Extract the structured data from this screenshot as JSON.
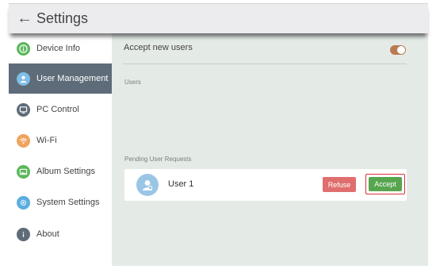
{
  "header": {
    "back_glyph": "←",
    "title": "Settings"
  },
  "sidebar": {
    "items": [
      {
        "label": "Device Info",
        "icon": "info-icon",
        "color": "#5cb85c",
        "active": false
      },
      {
        "label": "User Management",
        "icon": "user-icon",
        "color": "#7fbde8",
        "active": true
      },
      {
        "label": "PC Control",
        "icon": "monitor-icon",
        "color": "#5d6c78",
        "active": false
      },
      {
        "label": "Wi-Fi",
        "icon": "wifi-icon",
        "color": "#f0a35c",
        "active": false
      },
      {
        "label": "Album Settings",
        "icon": "image-icon",
        "color": "#5cb85c",
        "active": false
      },
      {
        "label": "System Settings",
        "icon": "gear-icon",
        "color": "#5aaee0",
        "active": false
      },
      {
        "label": "About",
        "icon": "info-icon",
        "color": "#5d6c78",
        "active": false
      }
    ]
  },
  "main": {
    "accept_new_users_label": "Accept new users",
    "accept_new_users_on": true,
    "users_section_label": "Users",
    "pending_section_label": "Pending User Requests",
    "pending_requests": [
      {
        "name": "User 1",
        "refuse_label": "Refuse",
        "accept_label": "Accept"
      }
    ]
  },
  "colors": {
    "active_nav": "#5d6c78",
    "toggle_on": "#b97a50",
    "refuse": "#e06e6e",
    "accept": "#57a64f",
    "highlight_border": "#d9333a"
  }
}
